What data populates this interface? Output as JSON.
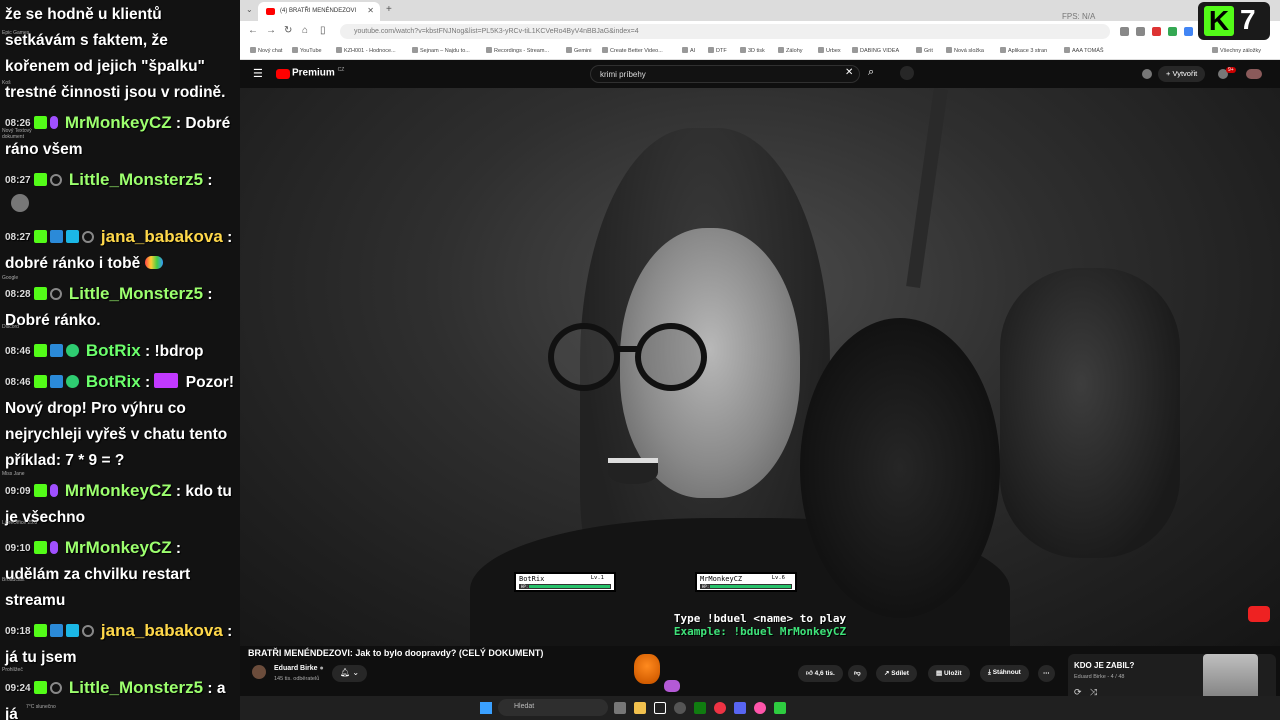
{
  "chat": {
    "first_msg_text": "že se hodně u klientů setkávám s faktem, že kořenem od jejich \"špalku\" trestné činnosti jsou v rodině.",
    "messages": [
      {
        "time": "08:26",
        "user": "MrMonkeyCZ",
        "text": "Dobré ráno všem"
      },
      {
        "time": "08:27",
        "user": "Little_Monsterz5",
        "text": ""
      },
      {
        "time": "08:27",
        "user": "jana_babakova",
        "text": "dobré ránko i tobě"
      },
      {
        "time": "08:28",
        "user": "Little_Monsterz5",
        "text": "Dobré ránko."
      },
      {
        "time": "08:46",
        "user": "BotRix",
        "text": "!bdrop"
      },
      {
        "time": "08:46",
        "user": "BotRix",
        "text": "Pozor! Nový drop! Pro výhru co nejrychleji vyřeš v chatu tento příklad: 7 * 9 = ?"
      },
      {
        "time": "09:09",
        "user": "MrMonkeyCZ",
        "text": "kdo tu je všechno"
      },
      {
        "time": "09:10",
        "user": "MrMonkeyCZ",
        "text": "udělám za chvilku restart streamu"
      },
      {
        "time": "09:18",
        "user": "jana_babakova",
        "text": "já tu jsem"
      },
      {
        "time": "09:24",
        "user": "Little_Monsterz5",
        "text": "a já"
      }
    ]
  },
  "desktop": {
    "notes": [
      "Epic Games",
      "Koš",
      "Nový Textový dokument",
      "Google",
      "Discord",
      "Miss Jane",
      "LibreOffice 25.8",
      "Broadcast",
      "Prohlížeč",
      "7°C slunečno"
    ]
  },
  "browser": {
    "tab_title": "(4) BRATŘI MENÉNDEZOVI",
    "url": "youtube.com/watch?v=kbstFNJNog&list=PL5K3-yRCv-tiL1KCVeRo4ByV4nBBJaG&index=4",
    "fps": "FPS: N/A",
    "bookmarks": [
      "Nový chat",
      "YouTube",
      "KZH001 - Hodnoce...",
      "Sejnam – Najdu to...",
      "Recordings - Stream...",
      "Gemini",
      "Create Better Video...",
      "AI",
      "DTF",
      "3D tisk",
      "Zálohy",
      "Urbex",
      "DABING VIDEA",
      "Grit",
      "Nová složka",
      "Aplikace 3 stran",
      "AAA TOMÁŠ",
      "Všechny záložky"
    ]
  },
  "youtube": {
    "brand": "Premium",
    "brand_suffix": "CZ",
    "search_query": "krimi príbehy",
    "create_label": "Vytvořit",
    "notif_count": "9+",
    "video_title": "BRATŘI MENÉNDEZOVI: Jak to bylo doopravdy? (CELÝ DOKUMENT)",
    "channel_name": "Eduard Birke",
    "subscribers": "145 tis. odběratelů",
    "likes": "4,6 tis.",
    "share": "Sdílet",
    "save": "Uložit",
    "download": "Stáhnout",
    "playlist_title": "KDO JE ZABIL?",
    "playlist_sub": "Eduard Birke - 4 / 48"
  },
  "duel": {
    "p1_name": "BotRix",
    "p1_lv": "Lv.1",
    "p1_hp": 1.0,
    "p2_name": "MrMonkeyCZ",
    "p2_lv": "Lv.6",
    "p2_hp": 1.0,
    "hp_label": "HP:",
    "line1": "Type !bduel <name> to play",
    "line2": "Example: !bduel MrMonkeyCZ"
  },
  "taskbar": {
    "search_placeholder": "Hledat"
  },
  "kick": {
    "letter": "K",
    "viewers": "7"
  },
  "colors": {
    "kick_green": "#53fc18",
    "youtube_red": "#ff0000",
    "username_green": "#9cff6e",
    "username_gold": "#ffd84a"
  }
}
